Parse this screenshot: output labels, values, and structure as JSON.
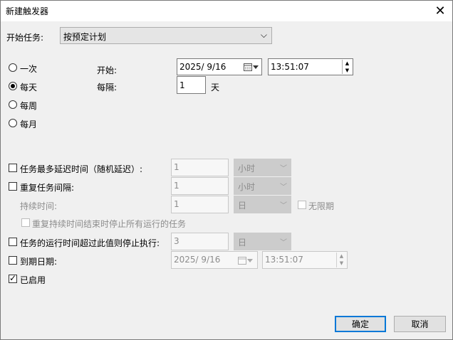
{
  "window": {
    "title": "新建触发器",
    "close_glyph": "✕"
  },
  "begin_task": {
    "label": "开始任务:",
    "value": "按预定计划",
    "chevron": "⌵"
  },
  "schedule": {
    "options": [
      {
        "label": "一次",
        "selected": false
      },
      {
        "label": "每天",
        "selected": true
      },
      {
        "label": "每周",
        "selected": false
      },
      {
        "label": "每月",
        "selected": false
      }
    ],
    "start_label": "开始:",
    "start_date": "2025/  9/16",
    "start_time": "13:51:07",
    "recur_label": "每隔:",
    "recur_value": "1",
    "recur_unit": "天"
  },
  "advanced": {
    "delay": {
      "label": "任务最多延迟时间（随机延迟）:",
      "value": "1",
      "unit": "小时",
      "checked": false
    },
    "repeat": {
      "label": "重复任务间隔:",
      "value": "1",
      "unit": "小时",
      "checked": false
    },
    "duration": {
      "label": "持续时间:",
      "value": "1",
      "unit": "日",
      "indefinite_label": "无限期",
      "indefinite_checked": false
    },
    "stop_at_end": {
      "label": "重复持续时间结束时停止所有运行的任务",
      "checked": false
    },
    "stop_if_longer": {
      "label": "任务的运行时间超过此值则停止执行:",
      "value": "3",
      "unit": "日",
      "checked": false
    },
    "expire": {
      "label": "到期日期:",
      "date": "2025/  9/16",
      "time": "13:51:07",
      "checked": false
    },
    "enabled": {
      "label": "已启用",
      "checked": true
    }
  },
  "buttons": {
    "ok": "确定",
    "cancel": "取消"
  },
  "icons": {
    "calendar": "calendar-icon",
    "chevron": "chevron-down-icon",
    "spin_up": "▲",
    "spin_down": "▼"
  },
  "colors": {
    "accent": "#0078d7",
    "window_bg": "#f0f0f0",
    "disabled_text": "#8c8c8c"
  }
}
